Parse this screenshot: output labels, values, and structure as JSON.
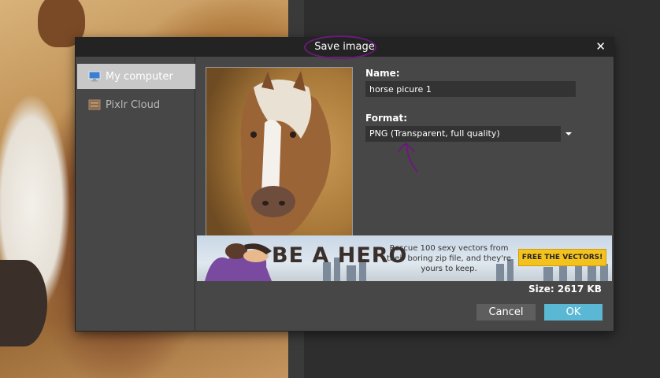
{
  "dialog": {
    "title": "Save image",
    "close_icon": "close-icon"
  },
  "sidebar": {
    "items": [
      {
        "label": "My computer",
        "icon": "monitor-icon",
        "active": true
      },
      {
        "label": "Pixlr Cloud",
        "icon": "cloud-storage-icon",
        "active": false
      }
    ]
  },
  "form": {
    "name_label": "Name:",
    "name_value": "horse picure 1",
    "format_label": "Format:",
    "format_value": "PNG (Transparent, full quality)"
  },
  "ad": {
    "title": "BE A HERO",
    "text": "Rescue 100 sexy vectors from their boring zip file, and they're yours to keep.",
    "cta": "FREE THE VECTORS!"
  },
  "size_text": "Size: 2617 KB",
  "buttons": {
    "cancel": "Cancel",
    "ok": "OK"
  },
  "colors": {
    "dialog_bg": "#474747",
    "title_bar": "#232323",
    "ok_button": "#5bb8d4",
    "cancel_button": "#5e5e5e",
    "annotation": "#6b1a7a",
    "cta": "#f4c21f"
  }
}
